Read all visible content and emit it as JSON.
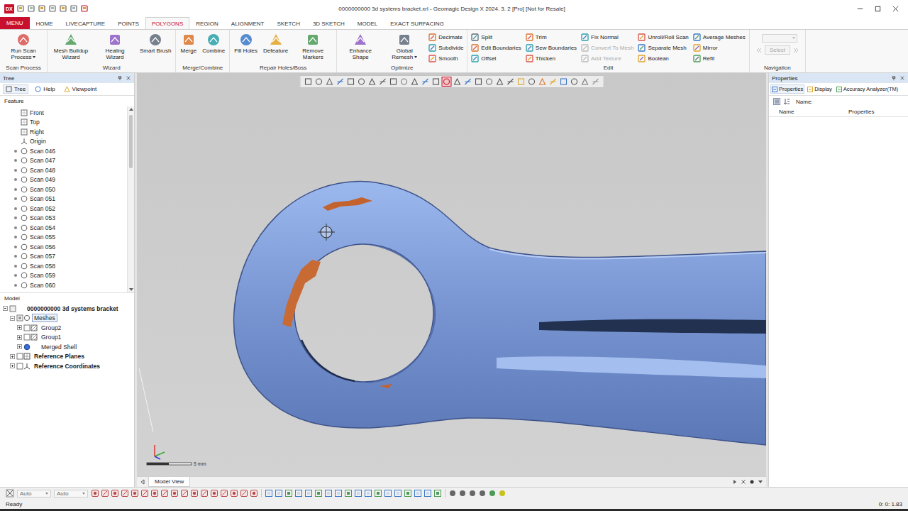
{
  "window": {
    "logo": "DX",
    "title": "0000000000 3d systems bracket.xrl - Geomagic Design X 2024. 3. 2 [Pro] [Not for Resale]"
  },
  "menu_button": "MENU",
  "tabs": [
    {
      "label": "HOME",
      "selected": false
    },
    {
      "label": "LIVECAPTURE",
      "selected": false
    },
    {
      "label": "POINTS",
      "selected": false
    },
    {
      "label": "POLYGONS",
      "selected": true
    },
    {
      "label": "REGION",
      "selected": false
    },
    {
      "label": "ALIGNMENT",
      "selected": false
    },
    {
      "label": "SKETCH",
      "selected": false
    },
    {
      "label": "3D SKETCH",
      "selected": false
    },
    {
      "label": "MODEL",
      "selected": false
    },
    {
      "label": "EXACT SURFACING",
      "selected": false
    }
  ],
  "ribbon": {
    "groups": [
      {
        "label": "Scan Process",
        "items": [
          {
            "kind": "large",
            "label": "Run Scan Process",
            "dropdown": true,
            "disabled": false
          }
        ]
      },
      {
        "label": "Wizard",
        "items": [
          {
            "kind": "large",
            "label": "Mesh Buildup Wizard",
            "dropdown": false,
            "disabled": false
          },
          {
            "kind": "large",
            "label": "Healing Wizard",
            "dropdown": false,
            "disabled": false
          },
          {
            "kind": "large",
            "label": "Smart Brush",
            "dropdown": false,
            "disabled": false
          }
        ]
      },
      {
        "label": "Merge/Combine",
        "items": [
          {
            "kind": "large",
            "label": "Merge",
            "dropdown": false,
            "disabled": false
          },
          {
            "kind": "large",
            "label": "Combine",
            "dropdown": false,
            "disabled": false
          }
        ]
      },
      {
        "label": "Repair Holes/Boss",
        "items": [
          {
            "kind": "large",
            "label": "Fill Holes",
            "dropdown": false,
            "disabled": false
          },
          {
            "kind": "large",
            "label": "Defeature",
            "dropdown": false,
            "disabled": false
          },
          {
            "kind": "large",
            "label": "Remove Markers",
            "dropdown": false,
            "disabled": false
          }
        ]
      },
      {
        "label": "Optimize",
        "items": [
          {
            "kind": "large",
            "label": "Enhance Shape",
            "dropdown": false,
            "disabled": false
          },
          {
            "kind": "large",
            "label": "Global Remesh",
            "dropdown": true,
            "disabled": false
          },
          {
            "kind": "stack",
            "items": [
              {
                "label": "Decimate",
                "disabled": false
              },
              {
                "label": "Subdivide",
                "disabled": false
              },
              {
                "label": "Smooth",
                "disabled": false
              }
            ]
          }
        ]
      },
      {
        "label": "Edit",
        "items": [
          {
            "kind": "stack",
            "items": [
              {
                "label": "Split",
                "disabled": false
              },
              {
                "label": "Edit Boundaries",
                "disabled": false
              },
              {
                "label": "Offset",
                "disabled": false
              }
            ]
          },
          {
            "kind": "stack",
            "items": [
              {
                "label": "Trim",
                "disabled": false
              },
              {
                "label": "Sew Boundaries",
                "disabled": false
              },
              {
                "label": "Thicken",
                "disabled": false
              }
            ]
          },
          {
            "kind": "stack",
            "items": [
              {
                "label": "Fix Normal",
                "disabled": false
              },
              {
                "label": "Convert To Mesh",
                "disabled": true
              },
              {
                "label": "Add Texture",
                "disabled": true
              }
            ]
          },
          {
            "kind": "stack",
            "items": [
              {
                "label": "Unroll/Roll Scan",
                "disabled": false
              },
              {
                "label": "Separate Mesh",
                "disabled": false
              },
              {
                "label": "Boolean",
                "disabled": false
              }
            ]
          },
          {
            "kind": "stack",
            "items": [
              {
                "label": "Average Meshes",
                "disabled": false
              },
              {
                "label": "Mirror",
                "disabled": false
              },
              {
                "label": "Refit",
                "disabled": false
              }
            ]
          }
        ]
      }
    ],
    "navigation": {
      "label": "Navigation",
      "field": "Select",
      "disabled": true
    }
  },
  "tree_panel": {
    "title": "Tree",
    "tabs": [
      {
        "label": "Tree",
        "selected": true
      },
      {
        "label": "Help",
        "selected": false
      },
      {
        "label": "Viewpoint",
        "selected": false
      }
    ],
    "feature_header": "Feature",
    "features": [
      {
        "label": "Front",
        "kind": "plane"
      },
      {
        "label": "Top",
        "kind": "plane"
      },
      {
        "label": "Right",
        "kind": "plane"
      },
      {
        "label": "Origin",
        "kind": "origin"
      },
      {
        "label": "Scan 046",
        "kind": "scan"
      },
      {
        "label": "Scan 047",
        "kind": "scan"
      },
      {
        "label": "Scan 048",
        "kind": "scan"
      },
      {
        "label": "Scan 049",
        "kind": "scan"
      },
      {
        "label": "Scan 050",
        "kind": "scan"
      },
      {
        "label": "Scan 051",
        "kind": "scan"
      },
      {
        "label": "Scan 052",
        "kind": "scan"
      },
      {
        "label": "Scan 053",
        "kind": "scan"
      },
      {
        "label": "Scan 054",
        "kind": "scan"
      },
      {
        "label": "Scan 055",
        "kind": "scan"
      },
      {
        "label": "Scan 056",
        "kind": "scan"
      },
      {
        "label": "Scan 057",
        "kind": "scan"
      },
      {
        "label": "Scan 058",
        "kind": "scan"
      },
      {
        "label": "Scan 059",
        "kind": "scan"
      },
      {
        "label": "Scan 060",
        "kind": "scan"
      }
    ],
    "model_header": "Model",
    "model_tree": [
      {
        "label": "0000000000 3d systems bracket",
        "kind": "root",
        "bold": true,
        "selected": false,
        "expandable": true,
        "expanded": true,
        "children": [
          {
            "label": "Meshes",
            "kind": "meshes",
            "bold": false,
            "selected": true,
            "expandable": true,
            "expanded": true,
            "children": [
              {
                "label": "Group2",
                "kind": "group",
                "bold": false,
                "selected": false,
                "expandable": true,
                "expanded": false
              },
              {
                "label": "Group1",
                "kind": "group",
                "bold": false,
                "selected": false,
                "expandable": true,
                "expanded": false
              },
              {
                "label": "Merged Shell",
                "kind": "shell",
                "bold": false,
                "selected": false,
                "expandable": true,
                "expanded": false
              }
            ]
          },
          {
            "label": "Reference Planes",
            "kind": "planes",
            "bold": true,
            "selected": false,
            "expandable": true,
            "expanded": false
          },
          {
            "label": "Reference Coordinates",
            "kind": "coords",
            "bold": true,
            "selected": false,
            "expandable": true,
            "expanded": false
          }
        ]
      }
    ]
  },
  "viewport": {
    "scale_label": "5 mm",
    "view_tab": "Model View",
    "toolbar_tools": [
      {
        "selected": false
      },
      {
        "selected": false
      },
      {
        "selected": false
      },
      {
        "selected": false
      },
      {
        "selected": false
      },
      {
        "selected": false
      },
      {
        "selected": false
      },
      {
        "selected": false
      },
      {
        "selected": false
      },
      {
        "selected": false
      },
      {
        "selected": false
      },
      {
        "selected": false
      },
      {
        "selected": false
      },
      {
        "selected": true
      },
      {
        "selected": false
      },
      {
        "selected": false
      },
      {
        "selected": false
      },
      {
        "selected": false
      },
      {
        "selected": false
      },
      {
        "selected": false
      },
      {
        "selected": false
      },
      {
        "selected": false
      },
      {
        "selected": false
      },
      {
        "selected": false
      },
      {
        "selected": false
      },
      {
        "selected": false
      },
      {
        "selected": false
      },
      {
        "selected": false
      }
    ]
  },
  "properties_panel": {
    "title": "Properties",
    "tabs": [
      {
        "label": "Properties",
        "selected": true
      },
      {
        "label": "Display",
        "selected": false
      },
      {
        "label": "Accuracy Analyzer(TM)",
        "selected": false
      }
    ],
    "name_label": "Name:",
    "columns": [
      "Name",
      "Properties"
    ]
  },
  "bottom_toolbar": {
    "fields": [
      "Auto",
      "Auto"
    ]
  },
  "status_bar": {
    "text": "Ready",
    "timer": "0: 0: 1.83"
  }
}
